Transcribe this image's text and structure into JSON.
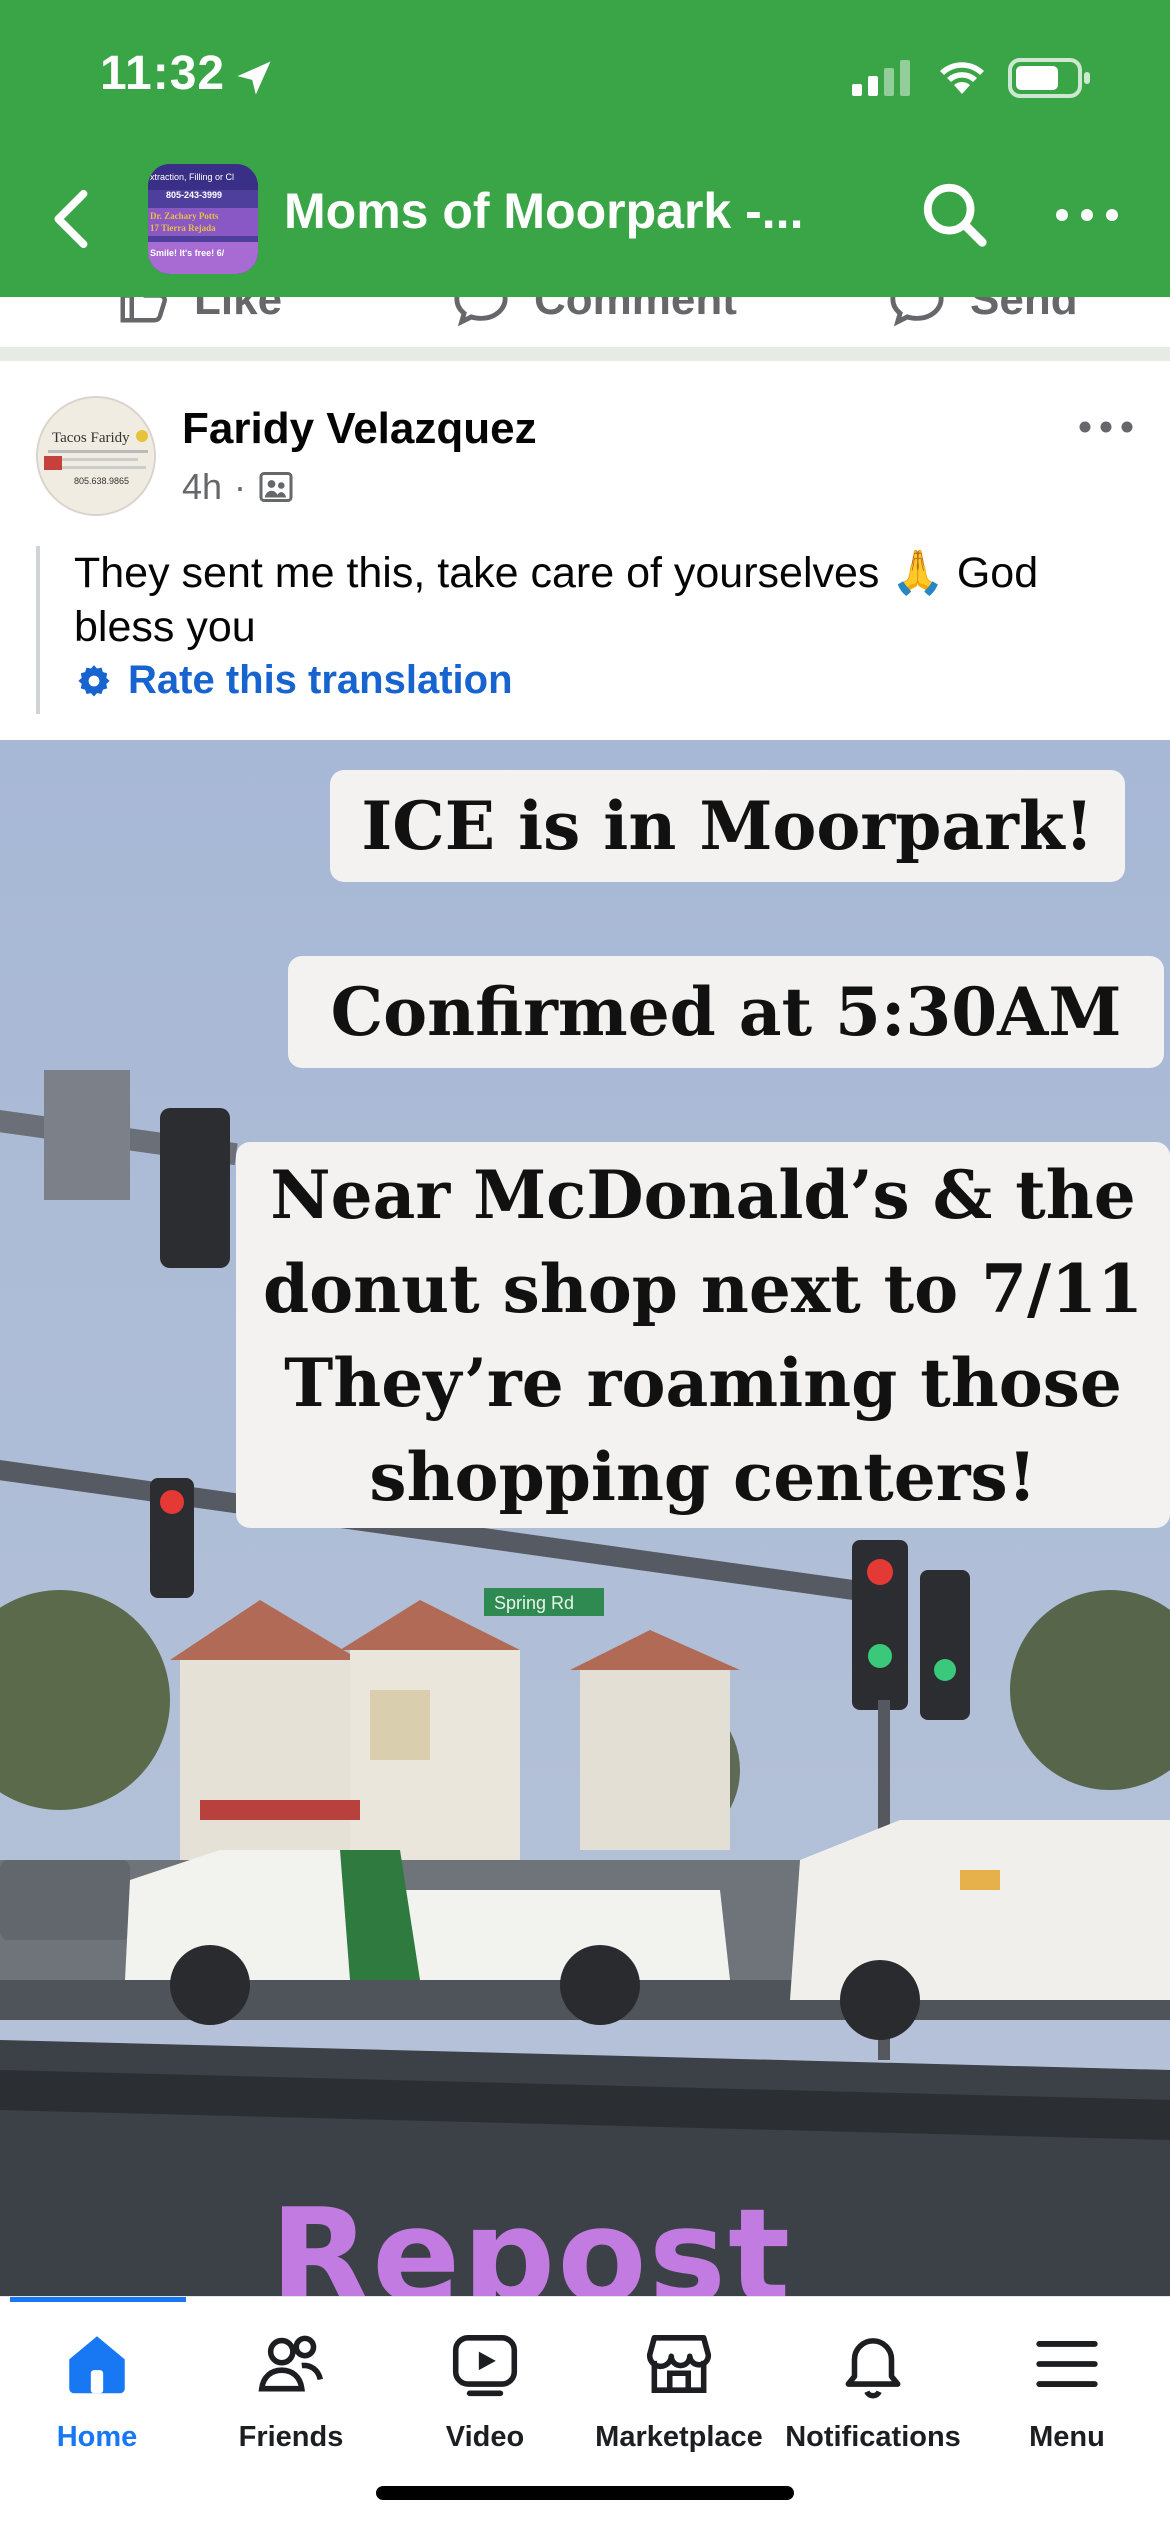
{
  "status_bar": {
    "time": "11:32"
  },
  "header": {
    "group_name": "Moms of Moorpark -...",
    "thumbnail": {
      "line1": "xtraction, Filling or Cl",
      "line2": "805-243-3999",
      "line3": "Dr. Zachary Potts",
      "line4": "17 Tierra Rejada",
      "line5": "Smile! It's free!  6/"
    }
  },
  "previous_post_actions": {
    "like": "Like",
    "comment": "Comment",
    "send": "Send"
  },
  "post": {
    "author": "Faridy Velazquez",
    "time_ago": "4h",
    "separator": "·",
    "avatar_text": {
      "brand": "Tacos Faridy",
      "phone": "805.638.9865"
    },
    "text": "They sent me this, take care of yourselves 🙏 God bless you",
    "rate_translation": "Rate this translation",
    "image": {
      "caption1": "ICE is in Moorpark!",
      "caption2": "Confirmed at 5:30AM",
      "caption3_lines": [
        "Near McDonald’s & the",
        "donut shop next to 7/11",
        "They’re roaming those",
        "shopping centers!"
      ],
      "street_sign": "Spring Rd",
      "overlay": "Repost"
    }
  },
  "tabbar": {
    "tabs": [
      {
        "label": "Home",
        "icon": "home-icon",
        "active": true
      },
      {
        "label": "Friends",
        "icon": "friends-icon"
      },
      {
        "label": "Video",
        "icon": "video-icon"
      },
      {
        "label": "Marketplace",
        "icon": "marketplace-icon"
      },
      {
        "label": "Notifications",
        "icon": "bell-icon"
      },
      {
        "label": "Menu",
        "icon": "menu-icon"
      }
    ]
  },
  "colors": {
    "header_green": "#3aa547",
    "link_blue": "#1763cf",
    "active_tab": "#1877f2",
    "repost_purple": "#c27be0"
  }
}
